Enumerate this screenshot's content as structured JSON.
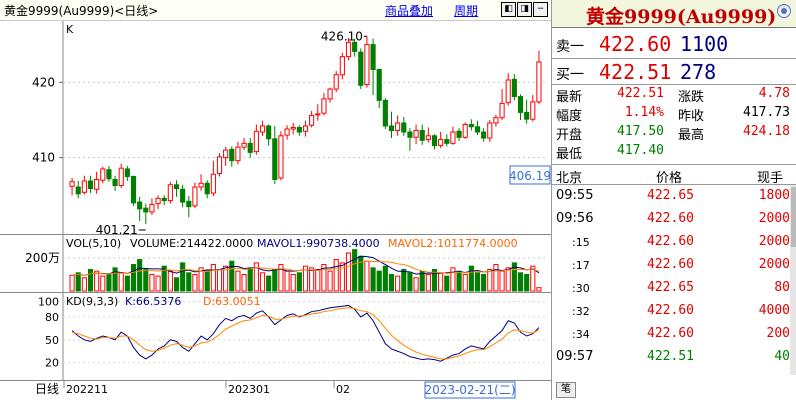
{
  "header": {
    "title": "黄金9999(Au9999)<日线>",
    "link_overlay": "商品叠加",
    "link_period": "周期",
    "nav_left": "◧",
    "nav_right": "◨",
    "nav_minus": "−"
  },
  "chart_labels": {
    "k_label": "K",
    "price_high_label": "426.10",
    "price_low_label": "401.21",
    "current_price_tag": "406.19",
    "y_ticks": [
      "420",
      "410"
    ],
    "vol_info": {
      "title": "VOL(5,10)",
      "volume": "VOLUME:214422.0000",
      "mavol1": "MAVOL1:990738.4000",
      "mavol2": "MAVOL2:1011774.0000"
    },
    "vol_axis": "200万",
    "kd_info": {
      "title": "KD(9,3,3)",
      "k": "K:66.5376",
      "d": "D:63.0051"
    },
    "kd_ticks": [
      "100",
      "80",
      "50",
      "20"
    ],
    "x_period": "日线",
    "x_labels": [
      "202211",
      "202301",
      "02"
    ],
    "cursor_date": "2023-02-21(二)"
  },
  "chart_data": {
    "type": "candlestick",
    "y_range": [
      400,
      428
    ],
    "candles": [
      [
        406.2,
        406.8,
        405.0,
        407.3
      ],
      [
        406.1,
        405.2,
        404.6,
        406.9
      ],
      [
        405.4,
        406.9,
        405.1,
        407.6
      ],
      [
        406.9,
        405.9,
        405.3,
        407.6
      ],
      [
        405.8,
        407.1,
        405.2,
        408.1
      ],
      [
        407.0,
        408.5,
        406.6,
        408.8
      ],
      [
        408.4,
        407.2,
        406.8,
        408.9
      ],
      [
        407.1,
        406.3,
        405.6,
        407.6
      ],
      [
        406.3,
        408.6,
        406.0,
        409.2
      ],
      [
        408.5,
        407.5,
        406.9,
        408.9
      ],
      [
        407.5,
        404.0,
        403.6,
        407.6
      ],
      [
        404.1,
        403.2,
        401.6,
        404.8
      ],
      [
        403.3,
        402.8,
        401.2,
        403.9
      ],
      [
        402.8,
        403.8,
        402.4,
        404.6
      ],
      [
        403.9,
        404.6,
        403.2,
        405.0
      ],
      [
        404.6,
        404.3,
        403.7,
        405.0
      ],
      [
        404.3,
        406.4,
        403.9,
        406.8
      ],
      [
        406.4,
        405.9,
        404.8,
        407.0
      ],
      [
        405.8,
        404.1,
        403.4,
        406.4
      ],
      [
        404.2,
        403.5,
        402.1,
        404.9
      ],
      [
        403.6,
        406.1,
        403.3,
        406.7
      ],
      [
        406.1,
        406.6,
        405.6,
        407.8
      ],
      [
        406.6,
        405.2,
        404.6,
        407.0
      ],
      [
        405.3,
        407.8,
        404.9,
        409.6
      ],
      [
        407.9,
        410.1,
        407.5,
        410.6
      ],
      [
        410.0,
        411.0,
        408.9,
        411.4
      ],
      [
        411.1,
        409.6,
        408.8,
        411.5
      ],
      [
        409.6,
        411.4,
        409.1,
        412.1
      ],
      [
        411.4,
        411.9,
        411.0,
        412.6
      ],
      [
        411.9,
        410.7,
        410.0,
        412.6
      ],
      [
        410.8,
        413.5,
        410.4,
        414.4
      ],
      [
        413.4,
        414.2,
        412.9,
        414.9
      ],
      [
        414.2,
        412.5,
        411.6,
        414.4
      ],
      [
        412.5,
        407.1,
        406.5,
        414.2
      ],
      [
        407.3,
        412.9,
        407.0,
        413.5
      ],
      [
        413.0,
        413.8,
        412.4,
        414.3
      ],
      [
        413.8,
        414.0,
        413.1,
        414.6
      ],
      [
        414.0,
        413.4,
        412.9,
        414.3
      ],
      [
        413.5,
        414.2,
        412.8,
        414.9
      ],
      [
        414.3,
        415.6,
        414.0,
        416.2
      ],
      [
        415.7,
        415.8,
        414.9,
        417.1
      ],
      [
        415.9,
        417.8,
        415.6,
        418.6
      ],
      [
        417.8,
        419.1,
        417.3,
        419.3
      ],
      [
        419.1,
        421.0,
        418.7,
        421.5
      ],
      [
        421.0,
        423.4,
        420.4,
        423.9
      ],
      [
        423.4,
        425.3,
        422.9,
        425.9
      ],
      [
        425.3,
        424.1,
        423.4,
        425.8
      ],
      [
        424.0,
        419.6,
        419.1,
        424.5
      ],
      [
        419.7,
        425.0,
        419.3,
        426.1
      ],
      [
        425.0,
        421.7,
        418.3,
        425.8
      ],
      [
        421.7,
        417.6,
        416.6,
        421.8
      ],
      [
        417.6,
        414.2,
        413.8,
        417.9
      ],
      [
        414.2,
        413.6,
        412.6,
        416.1
      ],
      [
        413.6,
        414.6,
        412.9,
        415.6
      ],
      [
        414.6,
        413.4,
        412.9,
        415.4
      ],
      [
        413.4,
        412.7,
        410.9,
        413.9
      ],
      [
        412.7,
        413.6,
        411.8,
        414.4
      ],
      [
        413.6,
        412.3,
        411.7,
        414.4
      ],
      [
        412.4,
        412.9,
        412.0,
        414.0
      ],
      [
        412.9,
        411.6,
        411.1,
        413.1
      ],
      [
        411.6,
        412.4,
        411.3,
        413.4
      ],
      [
        412.4,
        411.9,
        411.5,
        413.1
      ],
      [
        411.9,
        413.4,
        411.7,
        414.1
      ],
      [
        413.5,
        412.7,
        412.2,
        413.9
      ],
      [
        412.7,
        414.4,
        412.5,
        414.7
      ],
      [
        414.4,
        414.1,
        413.6,
        415.1
      ],
      [
        414.1,
        413.4,
        413.0,
        414.9
      ],
      [
        413.4,
        412.6,
        412.1,
        413.9
      ],
      [
        412.6,
        414.6,
        412.1,
        415.0
      ],
      [
        414.6,
        415.3,
        414.1,
        415.7
      ],
      [
        415.3,
        417.2,
        415.0,
        419.1
      ],
      [
        417.3,
        420.3,
        416.9,
        421.2
      ],
      [
        420.4,
        418.1,
        417.6,
        421.1
      ],
      [
        418.1,
        416.0,
        415.0,
        418.4
      ],
      [
        416.0,
        415.1,
        414.5,
        417.7
      ],
      [
        415.1,
        417.4,
        414.8,
        418.3
      ],
      [
        417.4,
        422.7,
        417.1,
        424.2
      ]
    ],
    "volume": [
      0.95,
      1.1,
      0.8,
      1.3,
      1.2,
      0.9,
      1.0,
      1.4,
      1.1,
      0.9,
      1.6,
      1.9,
      1.3,
      1.0,
      0.9,
      1.5,
      1.2,
      0.8,
      1.7,
      1.1,
      1.0,
      1.4,
      1.2,
      1.6,
      1.3,
      1.5,
      1.8,
      1.2,
      1.0,
      1.4,
      1.7,
      1.1,
      0.9,
      1.3,
      1.6,
      1.2,
      1.0,
      1.1,
      1.5,
      1.4,
      1.3,
      1.6,
      1.2,
      1.9,
      1.7,
      2.3,
      2.5,
      2.1,
      1.8,
      1.4,
      1.2,
      1.5,
      1.0,
      0.9,
      1.3,
      1.1,
      0.8,
      1.2,
      1.0,
      1.3,
      1.1,
      0.9,
      1.4,
      1.2,
      1.0,
      1.5,
      1.1,
      1.0,
      1.3,
      1.6,
      1.2,
      1.4,
      1.7,
      1.1,
      1.0,
      1.5,
      0.2
    ],
    "kd_range": [
      0,
      110
    ],
    "k": [
      62,
      55,
      50,
      48,
      52,
      55,
      53,
      50,
      60,
      55,
      40,
      30,
      25,
      30,
      38,
      42,
      50,
      48,
      40,
      35,
      45,
      55,
      50,
      58,
      70,
      78,
      75,
      80,
      82,
      78,
      85,
      88,
      80,
      70,
      76,
      82,
      84,
      80,
      83,
      87,
      88,
      90,
      92,
      93,
      94,
      95,
      90,
      80,
      85,
      75,
      60,
      45,
      38,
      35,
      32,
      28,
      26,
      24,
      25,
      24,
      22,
      26,
      30,
      32,
      38,
      42,
      40,
      38,
      48,
      55,
      62,
      75,
      72,
      60,
      55,
      58,
      66
    ],
    "d": [
      60,
      58,
      55,
      52,
      51,
      53,
      53,
      52,
      55,
      55,
      50,
      43,
      37,
      35,
      36,
      39,
      43,
      45,
      43,
      40,
      42,
      46,
      47,
      51,
      57,
      64,
      68,
      72,
      75,
      76,
      79,
      82,
      81,
      77,
      77,
      79,
      81,
      81,
      82,
      84,
      85,
      87,
      88,
      90,
      91,
      92,
      91,
      88,
      87,
      83,
      75,
      65,
      56,
      49,
      43,
      38,
      34,
      31,
      29,
      27,
      25,
      25,
      27,
      29,
      32,
      35,
      37,
      37,
      41,
      46,
      51,
      59,
      63,
      62,
      60,
      59,
      63
    ]
  },
  "right_panel": {
    "title": "黄金9999(Au9999)",
    "sell_label": "卖一",
    "sell_price": "422.60",
    "sell_vol": "1100",
    "buy_label": "买一",
    "buy_price": "422.51",
    "buy_vol": "278",
    "quote": {
      "latest_l": "最新",
      "latest_v": "422.51",
      "change_l": "涨跌",
      "change_v": "4.78",
      "range_l": "幅度",
      "range_v": "1.14%",
      "prevclose_l": "昨收",
      "prevclose_v": "417.73",
      "open_l": "开盘",
      "open_v": "417.50",
      "high_l": "最高",
      "high_v": "424.18",
      "low_l": "最低",
      "low_v": "417.40"
    },
    "ticks_head": {
      "place": "北京",
      "price": "价格",
      "vol": "现手"
    },
    "ticks": [
      {
        "time": "09:55",
        "price": "422.65",
        "vol": "1800",
        "sub": false
      },
      {
        "time": "09:56",
        "price": "422.60",
        "vol": "2000",
        "sub": false
      },
      {
        "time": ":15",
        "price": "422.60",
        "vol": "2000",
        "sub": true
      },
      {
        "time": ":17",
        "price": "422.60",
        "vol": "2000",
        "sub": true
      },
      {
        "time": ":30",
        "price": "422.65",
        "vol": "80",
        "sub": true
      },
      {
        "time": ":32",
        "price": "422.60",
        "vol": "4000",
        "sub": true
      },
      {
        "time": ":34",
        "price": "422.60",
        "vol": "200",
        "sub": true
      },
      {
        "time": "09:57",
        "price": "422.51",
        "vol": "40",
        "sub": false
      }
    ],
    "bottom_tab": "笔"
  },
  "colors": {
    "up": "#ff0000",
    "down": "#008000",
    "k_line": "#000080",
    "d_line": "#ff8800"
  }
}
